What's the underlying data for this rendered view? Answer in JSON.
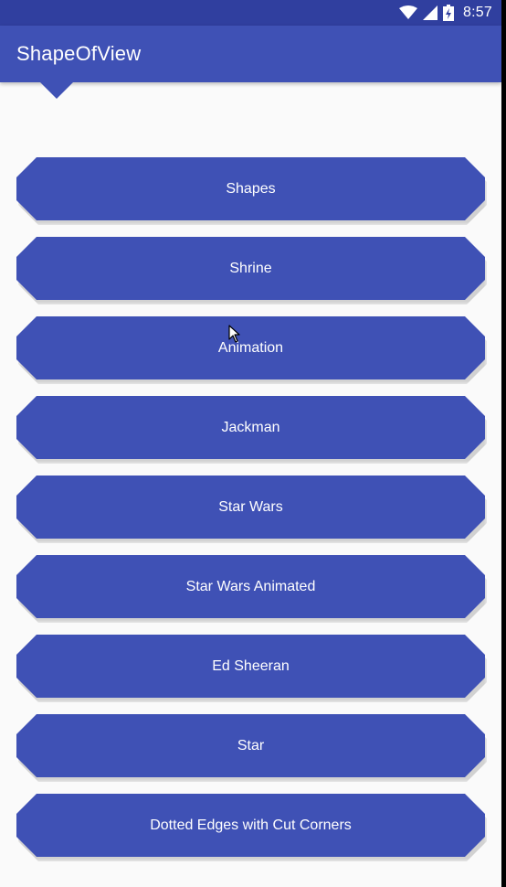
{
  "status_bar": {
    "time": "8:57",
    "icons": [
      "wifi-icon",
      "cell-signal-icon",
      "battery-icon"
    ]
  },
  "app_bar": {
    "title": "ShapeOfView"
  },
  "buttons": [
    {
      "label": "Shapes"
    },
    {
      "label": "Shrine"
    },
    {
      "label": "Animation"
    },
    {
      "label": "Jackman"
    },
    {
      "label": "Star Wars"
    },
    {
      "label": "Star Wars Animated"
    },
    {
      "label": "Ed Sheeran"
    },
    {
      "label": "Star"
    },
    {
      "label": "Dotted Edges with Cut Corners"
    }
  ],
  "colors": {
    "primary": "#3f51b5",
    "primary_dark": "#303f9f",
    "background": "#fafafa",
    "text_on_primary": "#ffffff"
  }
}
